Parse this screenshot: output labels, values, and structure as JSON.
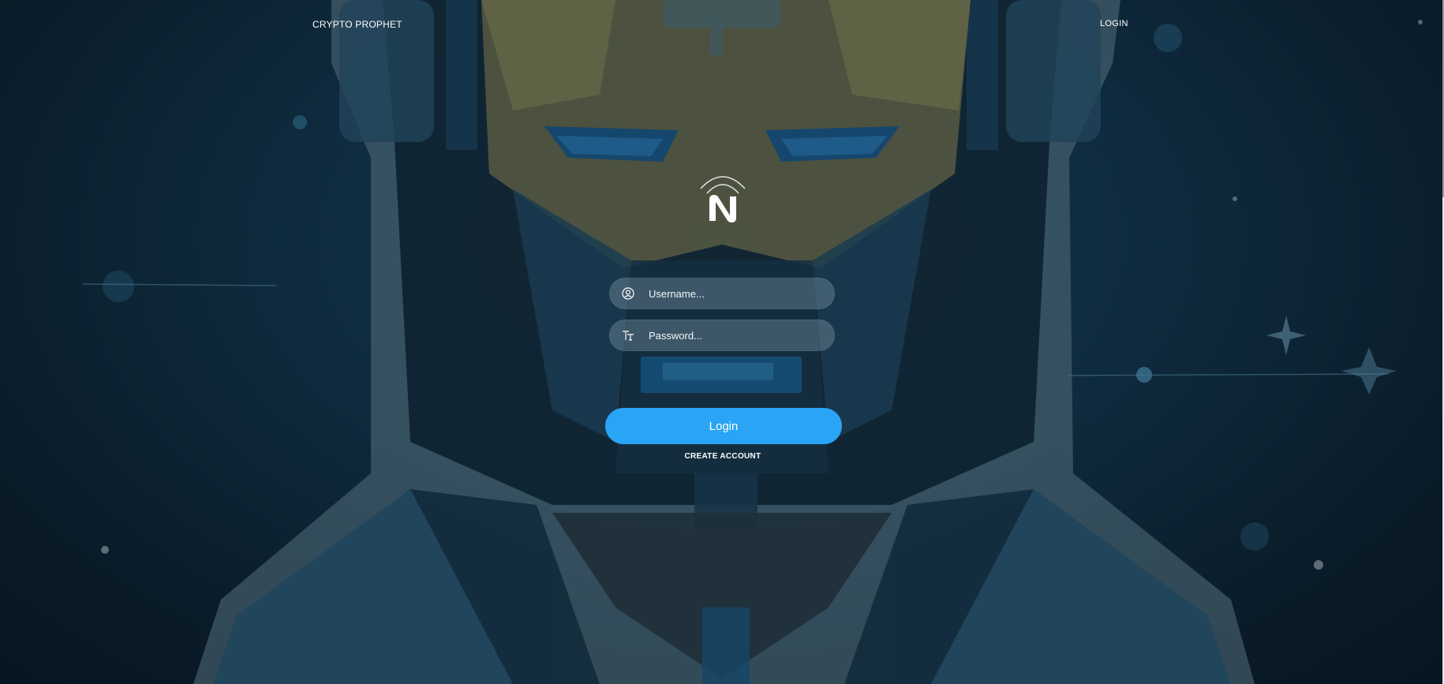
{
  "nav": {
    "brand": "CRYPTO PROPHET",
    "login_link": "LOGIN"
  },
  "form": {
    "username_placeholder": "Username...",
    "password_placeholder": "Password...",
    "login_button": "Login",
    "create_account": "CREATE ACCOUNT"
  },
  "icons": {
    "logo": "N-signal-logo",
    "username": "user-circle-icon",
    "password": "text-type-icon"
  },
  "colors": {
    "accent": "#2aa4f4",
    "background": "#123349"
  }
}
